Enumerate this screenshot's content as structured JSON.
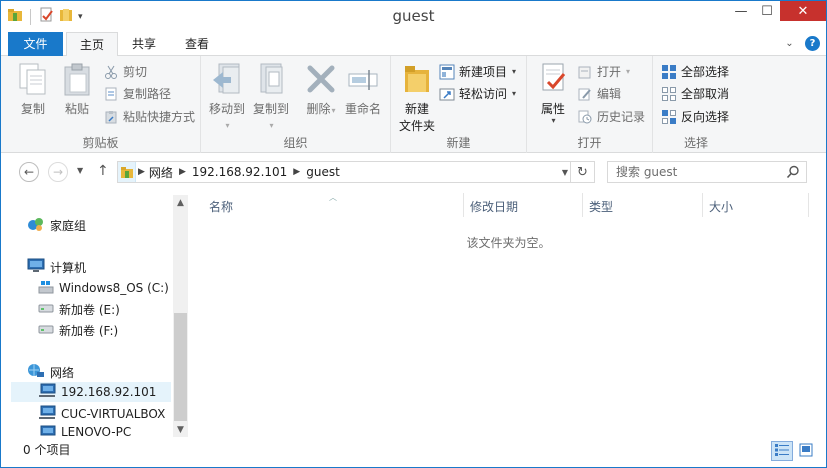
{
  "window": {
    "title": "guest"
  },
  "ribbon": {
    "tabs": {
      "file": "文件",
      "home": "主页",
      "share": "共享",
      "view": "查看"
    },
    "clipboard": {
      "label": "剪贴板",
      "copy": "复制",
      "paste": "粘贴",
      "cut": "剪切",
      "copy_path": "复制路径",
      "paste_shortcut": "粘贴快捷方式"
    },
    "organize": {
      "label": "组织",
      "move_to": "移动到",
      "copy_to": "复制到",
      "delete": "删除",
      "rename": "重命名"
    },
    "new": {
      "label": "新建",
      "new_folder_line1": "新建",
      "new_folder_line2": "文件夹",
      "new_item": "新建项目",
      "easy_access": "轻松访问"
    },
    "open": {
      "label": "打开",
      "properties": "属性",
      "open": "打开",
      "edit": "编辑",
      "history": "历史记录"
    },
    "select": {
      "label": "选择",
      "select_all": "全部选择",
      "select_none": "全部取消",
      "invert": "反向选择"
    }
  },
  "address": {
    "crumbs": [
      "网络",
      "192.168.92.101",
      "guest"
    ],
    "search_placeholder": "搜索 guest"
  },
  "navpane": {
    "homegroup": "家庭组",
    "computer": "计算机",
    "drive_c": "Windows8_OS (C:)",
    "drive_e": "新加卷 (E:)",
    "drive_f": "新加卷 (F:)",
    "network": "网络",
    "net_items": [
      "192.168.92.101",
      "CUC-VIRTUALBOX",
      "LENOVO-PC"
    ],
    "selected": "192.168.92.101"
  },
  "filelist": {
    "columns": [
      "名称",
      "修改日期",
      "类型",
      "大小"
    ],
    "empty_message": "该文件夹为空。"
  },
  "statusbar": {
    "item_count": "0 个项目"
  },
  "colors": {
    "accent": "#1979ca",
    "close": "#c7312d",
    "ribbon_bg": "#f5f6f7",
    "selection": "#e5f3fb"
  }
}
